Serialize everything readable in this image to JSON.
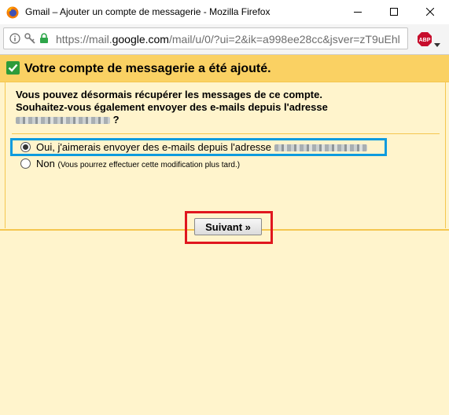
{
  "window": {
    "title": "Gmail – Ajouter un compte de messagerie - Mozilla Firefox"
  },
  "urlbar": {
    "url_prefix": "https://mail.",
    "url_host": "google.com",
    "url_rest": "/mail/u/0/?ui=2&ik=a998ee28cc&jsver=zT9uEhl"
  },
  "icons": {
    "app": "firefox-icon",
    "info": "info-icon",
    "key": "key-icon",
    "lock": "lock-icon",
    "adblock": "adblock-plus-icon",
    "check": "green-checkmark-icon"
  },
  "addon": {
    "abp_label": "ABP"
  },
  "panel": {
    "title": "Votre compte de messagerie a été ajouté.",
    "line1": "Vous pouvez désormais récupérer les messages de ce compte.",
    "line2": "Souhaitez-vous également envoyer des e-mails depuis l'adresse",
    "line3_suffix": "?"
  },
  "options": {
    "yes_label": "Oui, j'aimerais envoyer des e-mails depuis l'adresse",
    "no_label": "Non",
    "no_note": "(Vous pourrez effectuer cette modification plus tard.)",
    "selected": "yes"
  },
  "actions": {
    "next_label": "Suivant »"
  },
  "colors": {
    "header_bg": "#fad163",
    "panel_bg": "#fff4cc",
    "highlight_blue": "#0e9bde",
    "highlight_red": "#e0161e",
    "check_green": "#2e9b3a"
  }
}
